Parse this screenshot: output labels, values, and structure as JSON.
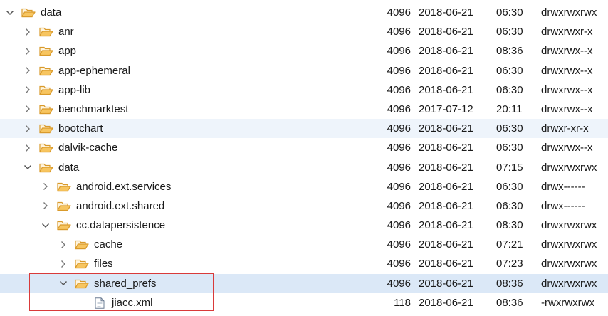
{
  "file_tree": {
    "rows": [
      {
        "name": "data",
        "size": "4096",
        "date": "2018-06-21",
        "time": "06:30",
        "perms": "drwxrwxrwx",
        "depth": 0,
        "type": "folder",
        "expanded": true,
        "state": ""
      },
      {
        "name": "anr",
        "size": "4096",
        "date": "2018-06-21",
        "time": "06:30",
        "perms": "drwxrwxr-x",
        "depth": 1,
        "type": "folder",
        "expanded": false,
        "state": ""
      },
      {
        "name": "app",
        "size": "4096",
        "date": "2018-06-21",
        "time": "08:36",
        "perms": "drwxrwx--x",
        "depth": 1,
        "type": "folder",
        "expanded": false,
        "state": ""
      },
      {
        "name": "app-ephemeral",
        "size": "4096",
        "date": "2018-06-21",
        "time": "06:30",
        "perms": "drwxrwx--x",
        "depth": 1,
        "type": "folder",
        "expanded": false,
        "state": ""
      },
      {
        "name": "app-lib",
        "size": "4096",
        "date": "2018-06-21",
        "time": "06:30",
        "perms": "drwxrwx--x",
        "depth": 1,
        "type": "folder",
        "expanded": false,
        "state": ""
      },
      {
        "name": "benchmarktest",
        "size": "4096",
        "date": "2017-07-12",
        "time": "20:11",
        "perms": "drwxrwx--x",
        "depth": 1,
        "type": "folder",
        "expanded": false,
        "state": ""
      },
      {
        "name": "bootchart",
        "size": "4096",
        "date": "2018-06-21",
        "time": "06:30",
        "perms": "drwxr-xr-x",
        "depth": 1,
        "type": "folder",
        "expanded": false,
        "state": "hover"
      },
      {
        "name": "dalvik-cache",
        "size": "4096",
        "date": "2018-06-21",
        "time": "06:30",
        "perms": "drwxrwx--x",
        "depth": 1,
        "type": "folder",
        "expanded": false,
        "state": ""
      },
      {
        "name": "data",
        "size": "4096",
        "date": "2018-06-21",
        "time": "07:15",
        "perms": "drwxrwxrwx",
        "depth": 1,
        "type": "folder",
        "expanded": true,
        "state": ""
      },
      {
        "name": "android.ext.services",
        "size": "4096",
        "date": "2018-06-21",
        "time": "06:30",
        "perms": "drwx------",
        "depth": 2,
        "type": "folder",
        "expanded": false,
        "state": ""
      },
      {
        "name": "android.ext.shared",
        "size": "4096",
        "date": "2018-06-21",
        "time": "06:30",
        "perms": "drwx------",
        "depth": 2,
        "type": "folder",
        "expanded": false,
        "state": ""
      },
      {
        "name": "cc.datapersistence",
        "size": "4096",
        "date": "2018-06-21",
        "time": "08:30",
        "perms": "drwxrwxrwx",
        "depth": 2,
        "type": "folder",
        "expanded": true,
        "state": ""
      },
      {
        "name": "cache",
        "size": "4096",
        "date": "2018-06-21",
        "time": "07:21",
        "perms": "drwxrwxrwx",
        "depth": 3,
        "type": "folder",
        "expanded": false,
        "state": ""
      },
      {
        "name": "files",
        "size": "4096",
        "date": "2018-06-21",
        "time": "07:23",
        "perms": "drwxrwxrwx",
        "depth": 3,
        "type": "folder",
        "expanded": false,
        "state": ""
      },
      {
        "name": "shared_prefs",
        "size": "4096",
        "date": "2018-06-21",
        "time": "08:36",
        "perms": "drwxrwxrwx",
        "depth": 3,
        "type": "folder",
        "expanded": true,
        "state": "selected"
      },
      {
        "name": "jiacc.xml",
        "size": "118",
        "date": "2018-06-21",
        "time": "08:36",
        "perms": "-rwxrwxrwx",
        "depth": 4,
        "type": "file",
        "expanded": false,
        "state": ""
      }
    ]
  },
  "icons": {
    "folder": "folder-open-icon",
    "file": "file-icon",
    "expanded": "chevron-down-icon",
    "collapsed": "chevron-right-icon"
  },
  "colors": {
    "hover_row": "#eef4fb",
    "selected_row": "#dbe8f7",
    "folder": "#e8a93a",
    "annotation_box": "#d93a3a"
  }
}
